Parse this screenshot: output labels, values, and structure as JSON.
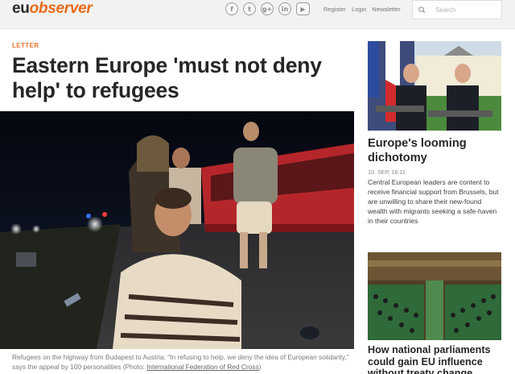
{
  "header": {
    "logo": {
      "part1": "eu",
      "part2": "observer"
    },
    "social": [
      {
        "icon": "facebook-icon",
        "glyph": "f"
      },
      {
        "icon": "twitter-icon",
        "glyph": "t"
      },
      {
        "icon": "google-plus-icon",
        "glyph": "g+"
      },
      {
        "icon": "linkedin-icon",
        "glyph": "in"
      },
      {
        "icon": "youtube-icon",
        "glyph": "▶"
      }
    ],
    "links": {
      "register": "Register",
      "login": "Login",
      "newsletter": "Newsletter"
    },
    "search": {
      "placeholder": "Search"
    }
  },
  "article": {
    "kicker": "LETTER",
    "headline": "Eastern Europe 'must not deny help' to refugees",
    "caption": "Refugees on the highway from Budapest to Austria. \"In refusing to help, we deny the idea of European solidarity,\" says the appeal by 100 personalities (Photo: ",
    "caption_link": "International Federation of Red Cross",
    "caption_end": ")"
  },
  "sidebar": {
    "story1": {
      "title": "Europe's looming dichotomy",
      "date": "10. SEP, 16:11",
      "summary": "Central European leaders are content to receive financial support from Brussels, but are unwilling to share their new-found wealth with migrants seeking a safe-haven in their countries"
    },
    "story2": {
      "title": "How national parliaments could gain EU influence without treaty change"
    }
  },
  "colors": {
    "accent": "#e8742a",
    "text": "#262626",
    "topbar": "#f2f2f2"
  }
}
